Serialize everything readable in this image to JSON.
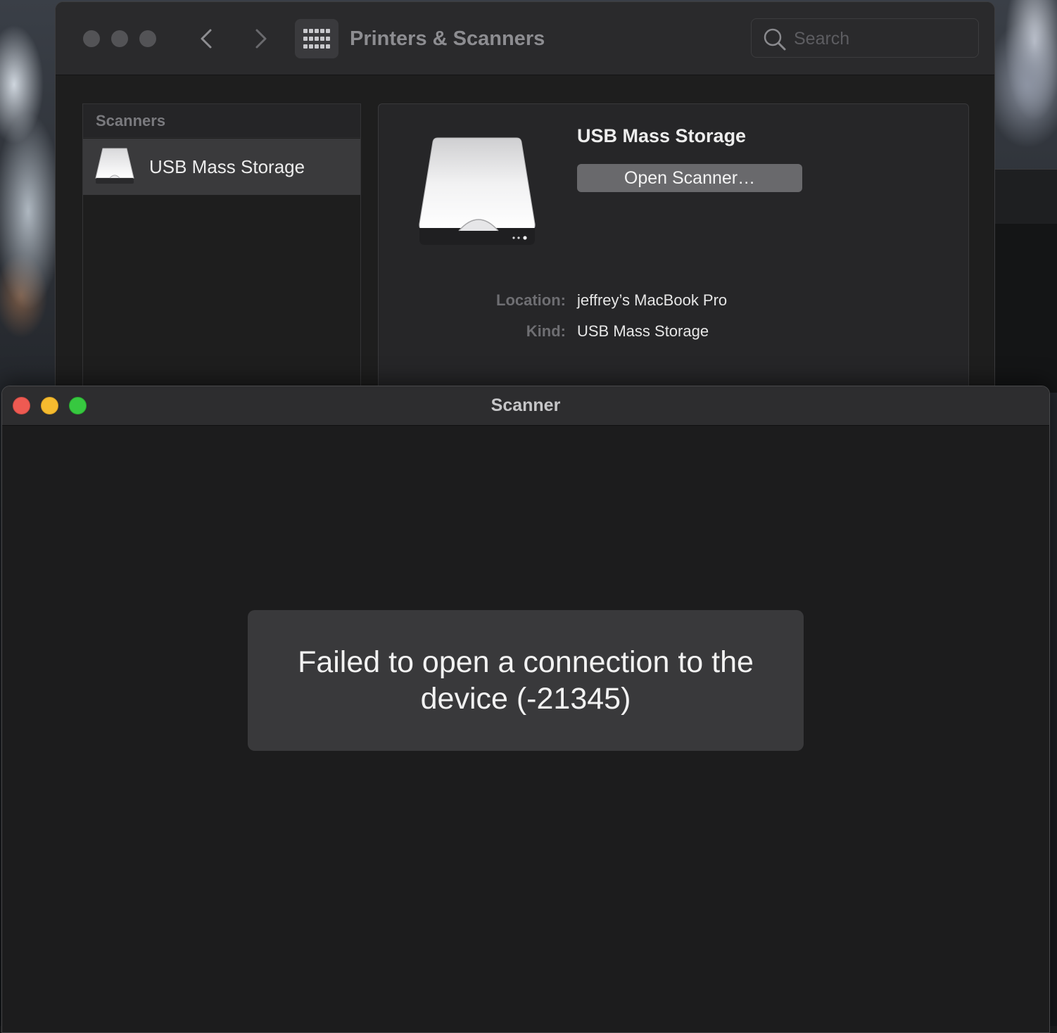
{
  "prefs_window": {
    "title": "Printers & Scanners",
    "search": {
      "placeholder": "Search"
    },
    "sidebar": {
      "header": "Scanners",
      "items": [
        {
          "label": "USB Mass Storage",
          "icon": "scanner-icon",
          "selected": true
        }
      ]
    },
    "detail": {
      "device_name": "USB Mass Storage",
      "open_button_label": "Open Scanner…",
      "location_label": "Location:",
      "location_value": "jeffrey’s MacBook Pro",
      "kind_label": "Kind:",
      "kind_value": "USB Mass Storage"
    }
  },
  "scanner_window": {
    "title": "Scanner",
    "error_message": "Failed to open a connection to the device (-21345)"
  },
  "colors": {
    "close": "#ee5a52",
    "minimize": "#f5bb2f",
    "zoom": "#37c840",
    "window_bg": "#1c1c1d",
    "error_box_bg": "#39393b"
  }
}
